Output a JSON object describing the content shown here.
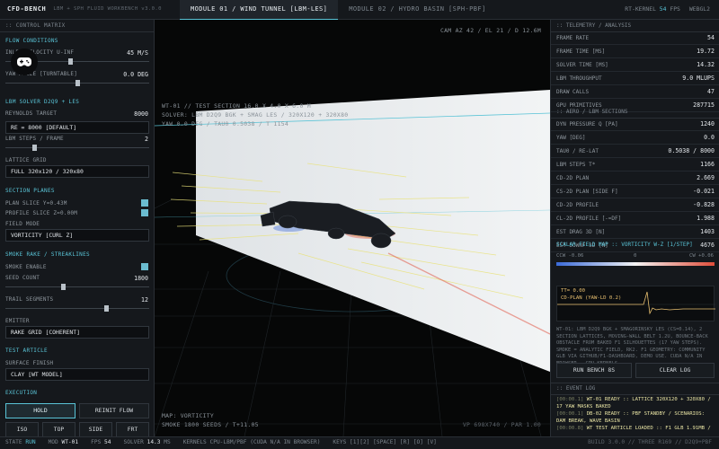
{
  "app": {
    "title": "CFD-BENCH",
    "subtitle": "LBM + SPH FLUID WORKBENCH v3.0.0"
  },
  "tabs": [
    {
      "label": "MODULE 01 / WIND TUNNEL [LBM-LES]",
      "active": true
    },
    {
      "label": "MODULE 02 / HYDRO BASIN [SPH-PBF]",
      "active": false
    }
  ],
  "topbar": {
    "kernel_label": "RT-KERNEL",
    "fps": "54",
    "fps_unit": "FPS",
    "api": "WEBGL2"
  },
  "left": {
    "header": ":: CONTROL MATRIX",
    "flow": {
      "title": "FLOW CONDITIONS",
      "inlet_label": "INLET VELOCITY U-INF",
      "inlet_value": "45 M/S",
      "inlet_level": 0.45,
      "yaw_label": "YAW ANGLE [TURNTABLE]",
      "yaw_value": "0.0 DEG",
      "yaw_level": 0.5
    },
    "solver": {
      "title": "LBM SOLVER D2Q9 + LES",
      "re_label": "REYNOLDS TARGET",
      "re_value": "8000",
      "re_select": "RE = 8000 [DEFAULT]",
      "steps_label": "LBM STEPS / FRAME",
      "steps_value": "2",
      "steps_level": 0.2,
      "grid_label": "LATTICE GRID",
      "grid_select": "FULL 320x120 / 320x80"
    },
    "planes": {
      "title": "SECTION PLANES",
      "plan_label": "PLAN SLICE Y=0.43M",
      "profile_label": "PROFILE SLICE Z=0.00M",
      "field_label": "FIELD MODE",
      "field_select": "VORTICITY [CURL Z]"
    },
    "smoke": {
      "title": "SMOKE RAKE / STREAKLINES",
      "enable_label": "SMOKE ENABLE",
      "seed_label": "SEED COUNT",
      "seed_value": "1800",
      "seed_level": 0.4,
      "trail_label": "TRAIL SEGMENTS",
      "trail_value": "12",
      "trail_level": 0.7,
      "emitter_label": "EMITTER",
      "emitter_select": "RAKE GRID [COHERENT]"
    },
    "article": {
      "title": "TEST ARTICLE",
      "surface_label": "SURFACE FINISH",
      "surface_select": "CLAY [WT MODEL]"
    },
    "execution": {
      "title": "EXECUTION",
      "hold": "HOLD",
      "reinit": "REINIT FLOW",
      "iso": "ISO",
      "top": "TOP",
      "side": "SIDE",
      "frt": "FRT"
    }
  },
  "viewport": {
    "line1": "WT-01 // TEST SECTION 16.0 X 4.0 X 6.0 M",
    "line2": "SOLVER: LBM D2Q9 BGK + SMAG LES / 320X120 + 320X80",
    "line3": "YAW 0.0 DEG / TAU0 0.5038 / T 1154",
    "camera": "CAM AZ 42 / EL 21 / D 12.6M",
    "map_label": "MAP: VORTICITY",
    "smoke_label": "SMOKE 1800 SEEDS / T+11.05",
    "vp_label": "VP 698X740 / PAR 1.00"
  },
  "right": {
    "header": ":: TELEMETRY / ANALYSIS",
    "telemetry": [
      {
        "k": "FRAME RATE",
        "v": "54"
      },
      {
        "k": "FRAME TIME [MS]",
        "v": "19.72"
      },
      {
        "k": "SOLVER TIME [MS]",
        "v": "14.32"
      },
      {
        "k": "LBM THROUGHPUT",
        "v": "9.0 MLUPS"
      },
      {
        "k": "DRAW CALLS",
        "v": "47"
      },
      {
        "k": "GPU PRIMITIVES",
        "v": "287715"
      }
    ],
    "aero_header": ":: AERO / LBM SECTIONS",
    "aero": [
      {
        "k": "DYN PRESSURE Q [PA]",
        "v": "1240"
      },
      {
        "k": "YAW [DEG]",
        "v": "0.0"
      },
      {
        "k": "TAU0 / RE-LAT",
        "v": "0.5038 / 8000"
      },
      {
        "k": "LBM STEPS T*",
        "v": "1166"
      },
      {
        "k": "CD-2D PLAN",
        "v": "2.669"
      },
      {
        "k": "CS-2D PLAN [SIDE F]",
        "v": "-0.021"
      },
      {
        "k": "CD-2D PROFILE",
        "v": "-0.828"
      },
      {
        "k": "CL-2D PROFILE [-=DF]",
        "v": "1.988"
      },
      {
        "k": "EST DRAG 3D [N]",
        "v": "1403"
      },
      {
        "k": "EST DOWNF 3D [N]",
        "v": "4676"
      }
    ],
    "scalar_label": "SCALAR FIELD MAP :: VORTICITY W-Z [1/STEP]",
    "colorbar": {
      "low": "CCW -0.06",
      "mid": "0",
      "high": "CW +0.06",
      "min_color": "#3a6ad8",
      "max_color": "#e04d3a"
    },
    "plot_tag": "TT= 0.00",
    "plot_series": "CD-PLAN (YAW-LD 0.2)",
    "info": "WT-01: LBM D2Q9 BGK + SMAGORINSKY LES (CS=0.14), 2 SECTION LATTICES, MOVING-WALL BELT 1.2U, BOUNCE-BACK OBSTACLE FROM BAKED F1 SILHOUETTES (17 YAW STEPS). SMOKE = ANALYTIC FIELD, RK2. F1 GEOMETRY: COMMUNITY GLB VIA GITHUB/F1-DASHBOARD, DEMO USE. CUDA N/A IN BROWSER - CPU KERNELS.",
    "run_bench": "RUN BENCH 8S",
    "clear_log": "CLEAR LOG",
    "log_header": ":: EVENT LOG",
    "log": [
      {
        "ts": "[00:00.1]",
        "text": "WT-01 READY :: LATTICE 320X120 + 320X80 / 17 YAW MASKS BAKED"
      },
      {
        "ts": "[00:00.1]",
        "text": "DB-02 READY :: PBF STANDBY / SCENARIOS: DAM BREAK, WAVE BASIN"
      },
      {
        "ts": "[00:00.8]",
        "text": "WT TEST ARTICLE LOADED :: F1 GLB 1.91MB /"
      }
    ]
  },
  "status": {
    "state_label": "STATE",
    "state": "RUN",
    "mod_label": "MOD",
    "mod": "WT-01",
    "fps_label": "FPS",
    "fps": "54",
    "solver_label": "SOLVER",
    "solver_ms": "14.3",
    "solver_unit": "MS",
    "kernels": "KERNELS CPU-LBM/PBF (CUDA N/A IN BROWSER)",
    "keys": "KEYS [1][2] [SPACE] [R] [O] [V]",
    "build": "BUILD 3.0.0 // THREE R169 // D2Q9+PBF"
  }
}
